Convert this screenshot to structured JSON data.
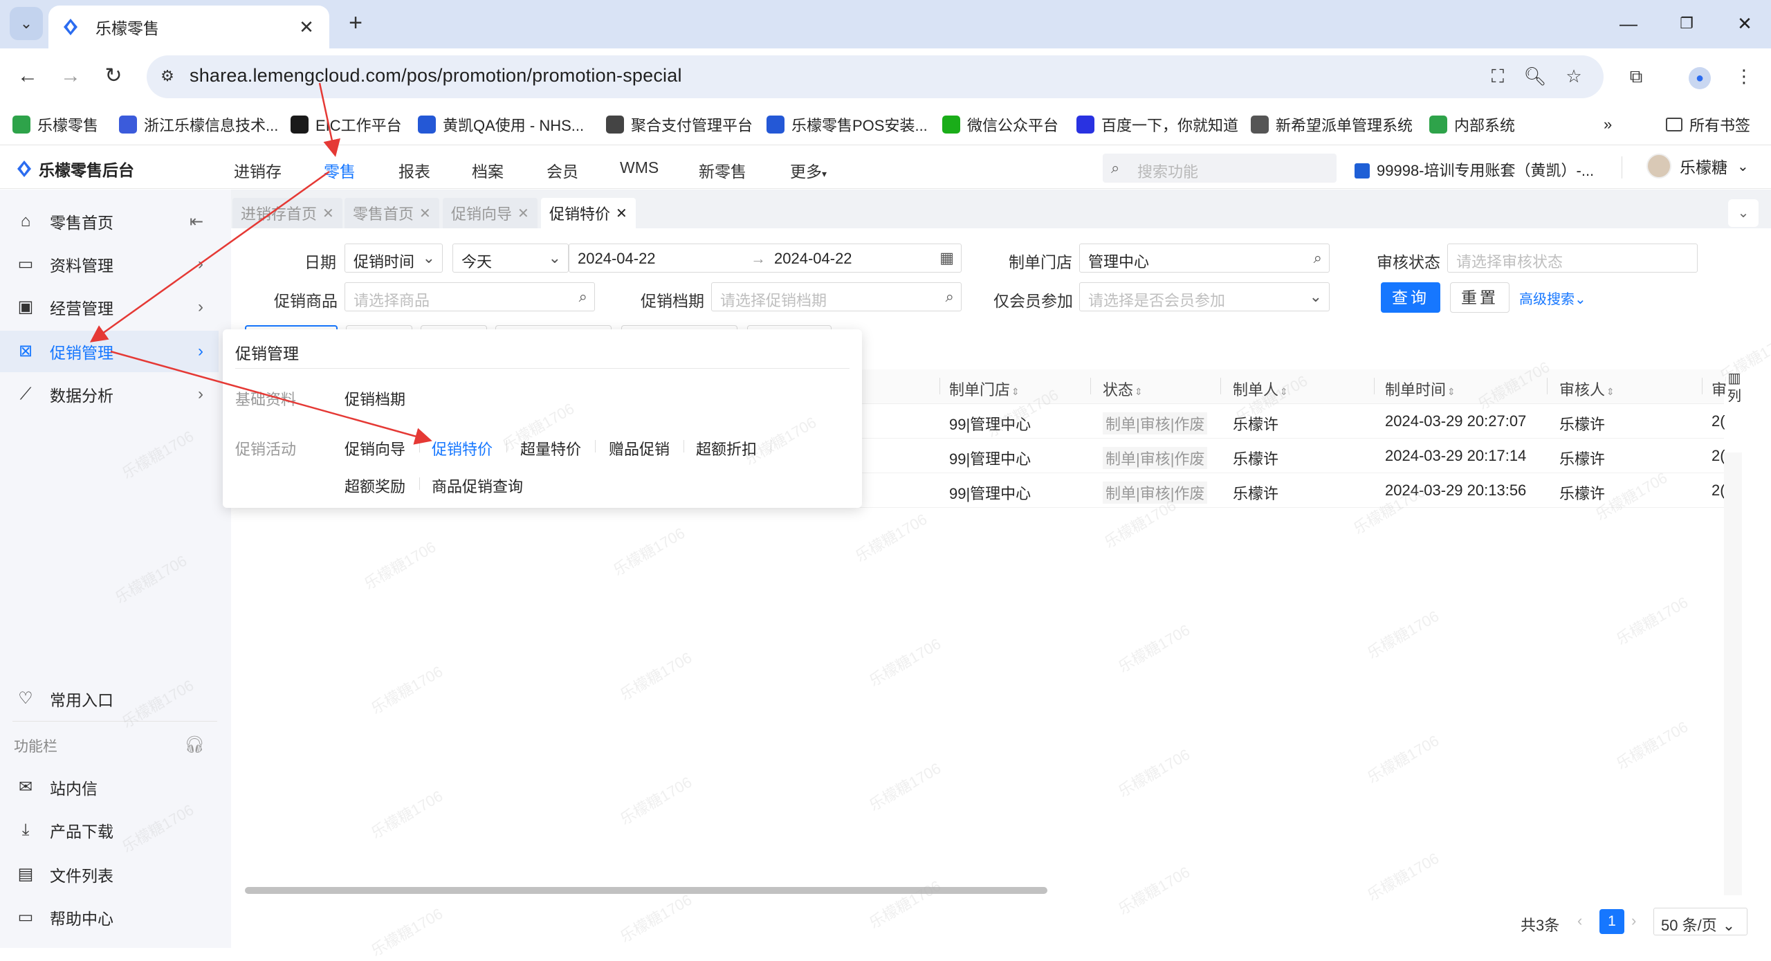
{
  "browser": {
    "tab_title": "乐檬零售",
    "url": "sharea.lemengcloud.com/pos/promotion/promotion-special",
    "bookmarks": [
      {
        "label": "乐檬零售",
        "color": "#2ea34a"
      },
      {
        "label": "浙江乐檬信息技术...",
        "color": "#3b5bdb"
      },
      {
        "label": "EIC工作平台",
        "color": "#1a1a1a"
      },
      {
        "label": "黄凯QA使用 - NHS...",
        "color": "#2458d6"
      },
      {
        "label": "聚合支付管理平台",
        "color": "#444444"
      },
      {
        "label": "乐檬零售POS安装...",
        "color": "#2458d6"
      },
      {
        "label": "微信公众平台",
        "color": "#1aad19"
      },
      {
        "label": "百度一下，你就知道",
        "color": "#2932e1"
      },
      {
        "label": "新希望派单管理系统",
        "color": "#555555"
      },
      {
        "label": "内部系统",
        "color": "#2ea34a"
      }
    ],
    "all_bookmarks": "所有书签"
  },
  "app": {
    "logo": "乐檬零售后台",
    "nav": [
      "进销存",
      "零售",
      "报表",
      "档案",
      "会员",
      "WMS",
      "新零售",
      "更多"
    ],
    "search_placeholder": "搜索功能",
    "account": "99998-培训专用账套（黄凯）-...",
    "user": "乐檬糖"
  },
  "sidebar": {
    "items": [
      {
        "label": "零售首页",
        "icon": "home-icon"
      },
      {
        "label": "资料管理",
        "icon": "folder-icon"
      },
      {
        "label": "经营管理",
        "icon": "chart-board-icon"
      },
      {
        "label": "促销管理",
        "icon": "promotion-icon"
      },
      {
        "label": "数据分析",
        "icon": "line-chart-icon"
      }
    ],
    "favorites": "常用入口",
    "group_label": "功能栏",
    "bottom_items": [
      {
        "label": "站内信",
        "icon": "mail-icon"
      },
      {
        "label": "产品下载",
        "icon": "download-icon"
      },
      {
        "label": "文件列表",
        "icon": "file-list-icon"
      },
      {
        "label": "帮助中心",
        "icon": "help-icon"
      }
    ]
  },
  "page_tabs": [
    "进销存首页",
    "零售首页",
    "促销向导",
    "促销特价"
  ],
  "filters": {
    "date_label": "日期",
    "date_type": "促销时间",
    "date_range": "今天",
    "date_start": "2024-04-22",
    "date_end": "2024-04-22",
    "store_label": "制单门店",
    "store_value": "管理中心",
    "audit_label": "审核状态",
    "audit_placeholder": "请选择审核状态",
    "product_label": "促销商品",
    "product_placeholder": "请选择商品",
    "schedule_label": "促销档期",
    "schedule_placeholder": "请选择促销档期",
    "member_label": "仅会员参加",
    "member_placeholder": "请选择是否会员参加",
    "query": "查询",
    "reset": "重置",
    "advanced": "高级搜索"
  },
  "table": {
    "columns": [
      "制单门店",
      "状态",
      "制单人",
      "制单时间",
      "审核人",
      "审"
    ],
    "column_settings": "列",
    "rows": [
      {
        "store": "99|管理中心",
        "status": "制单|审核|作废",
        "creator": "乐檬许",
        "time": "2024-03-29 20:27:07",
        "auditor": "乐檬许",
        "extra": "2("
      },
      {
        "store": "99|管理中心",
        "status": "制单|审核|作废",
        "creator": "乐檬许",
        "time": "2024-03-29 20:17:14",
        "auditor": "乐檬许",
        "extra": "2("
      },
      {
        "store": "99|管理中心",
        "status": "制单|审核|作废",
        "creator": "乐檬许",
        "time": "2024-03-29 20:13:56",
        "auditor": "乐檬许",
        "extra": "2("
      }
    ]
  },
  "pagination": {
    "total": "共3条",
    "current": "1",
    "page_size": "50 条/页"
  },
  "dropdown": {
    "title": "促销管理",
    "basic_label": "基础资料",
    "basic_items": [
      "促销档期"
    ],
    "activity_label": "促销活动",
    "activity_items": [
      "促销向导",
      "促销特价",
      "超量特价",
      "赠品促销",
      "超额折扣",
      "超额奖励",
      "商品促销查询"
    ]
  },
  "watermark": "乐檬糖1706",
  "colors": {
    "accent": "#1677ff",
    "arrow": "#e53935"
  }
}
